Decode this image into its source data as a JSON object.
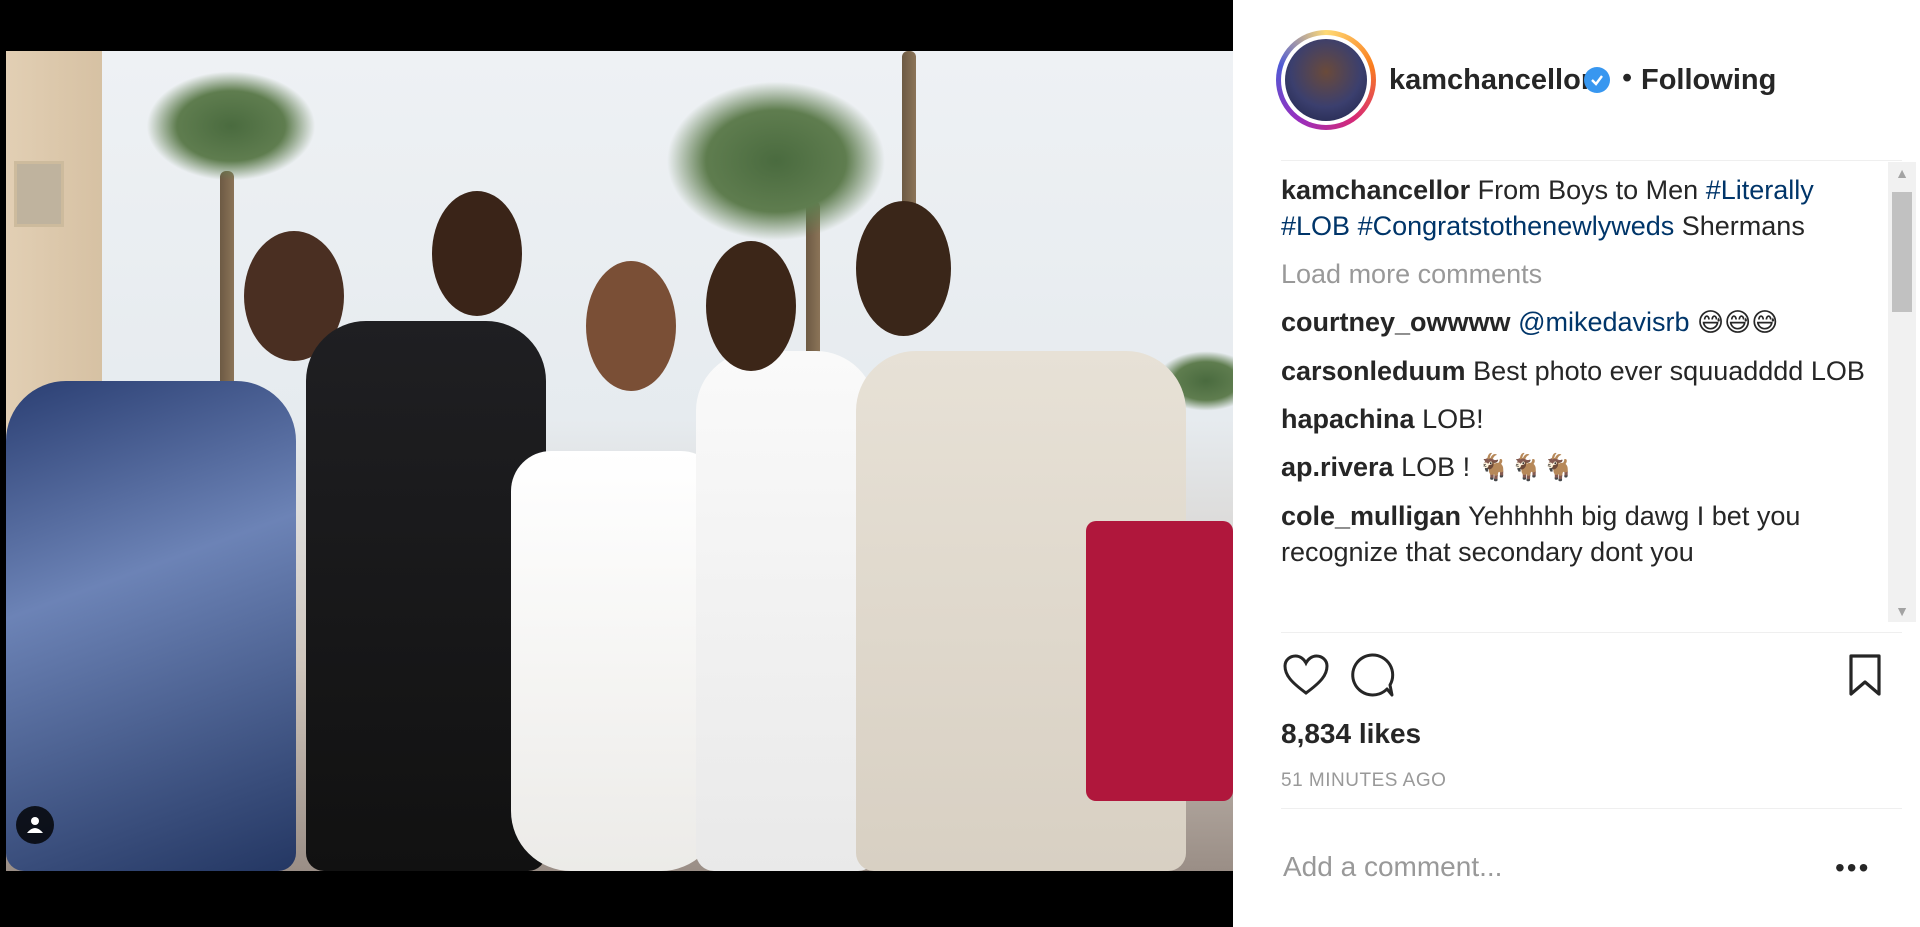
{
  "post": {
    "username": "kamchancellor",
    "separator": "•",
    "follow_status": "Following",
    "caption_user": "kamchancellor",
    "caption_text": "From Boys to Men",
    "caption_tags": [
      "#Literally",
      "#LOB",
      "#Congratstothenewlyweds"
    ],
    "caption_tail": "Shermans",
    "load_more": "Load more comments",
    "comments": [
      {
        "user": "courtney_owwww",
        "mention": "@mikedavisrb",
        "text": "",
        "emoji": "😅😅😅"
      },
      {
        "user": "carsonleduum",
        "mention": "",
        "text": "Best photo ever squuadddd LOB",
        "emoji": ""
      },
      {
        "user": "hapachina",
        "mention": "",
        "text": "LOB!",
        "emoji": ""
      },
      {
        "user": "ap.rivera",
        "mention": "",
        "text": "LOB !",
        "emoji": "🐐🐐🐐"
      },
      {
        "user": "cole_mulligan",
        "mention": "",
        "text": "Yehhhhh big dawg I bet you recognize that secondary dont you",
        "emoji": ""
      }
    ],
    "likes": "8,834 likes",
    "time": "51 MINUTES AGO",
    "add_comment_placeholder": "Add a comment...",
    "more_label": "•••"
  },
  "icons": {
    "like": "heart-icon",
    "comment": "comment-icon",
    "save": "bookmark-icon",
    "verified": "verified-badge-icon",
    "tag": "user-tag-icon"
  },
  "colors": {
    "link": "#003569",
    "verified": "#3897f0",
    "muted": "#999999",
    "text": "#262626"
  }
}
